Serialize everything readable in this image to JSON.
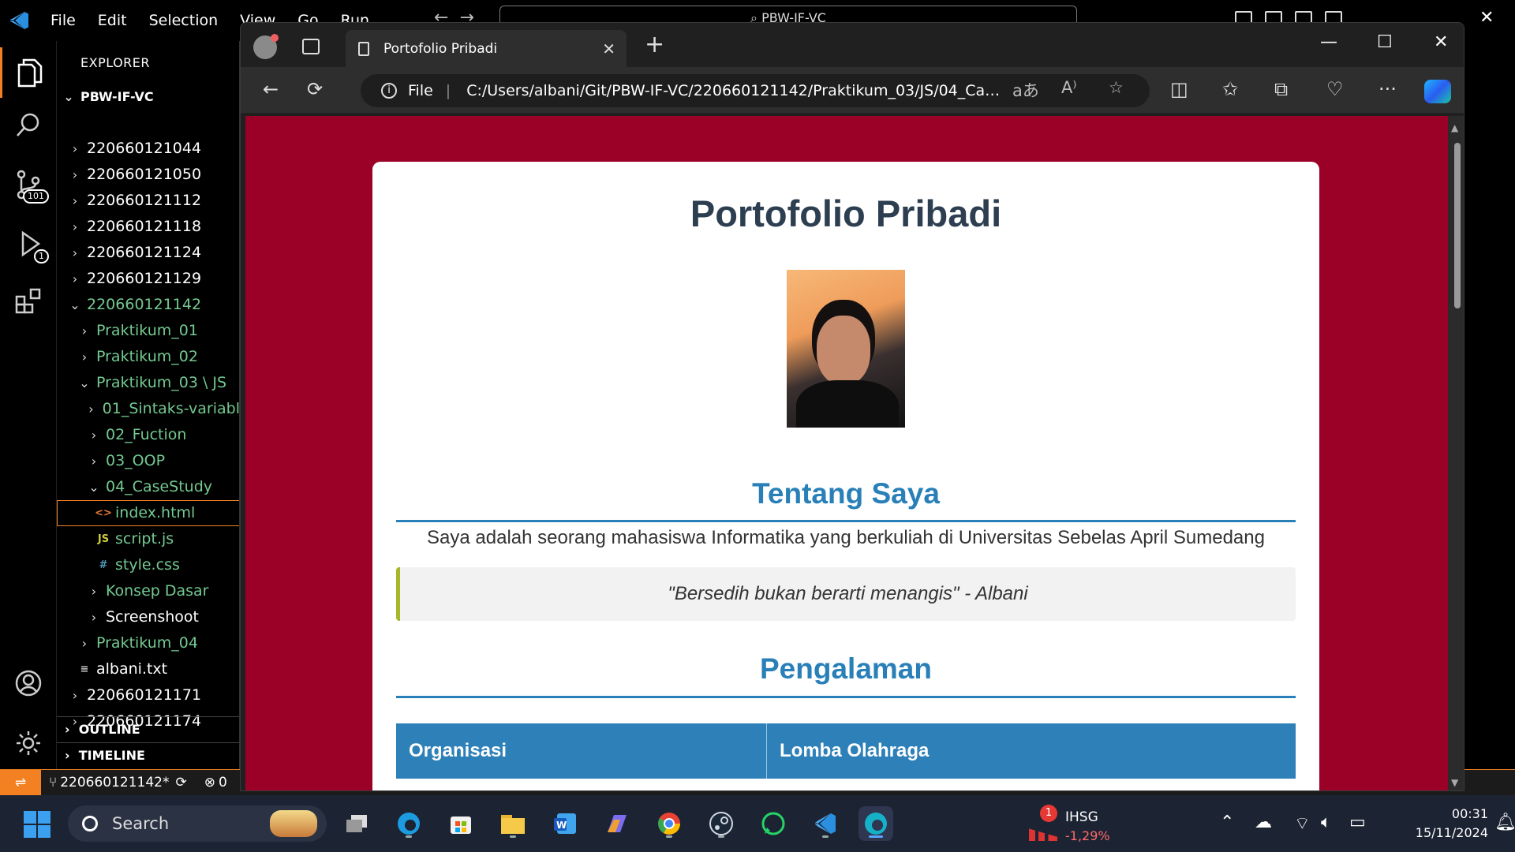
{
  "vscode": {
    "menu": [
      "File",
      "Edit",
      "Selection",
      "View",
      "Go",
      "Run",
      "…"
    ],
    "command_center": "PBW-IF-VC",
    "explorer_title": "EXPLORER",
    "root_folder": "PBW-IF-VC",
    "tree": [
      {
        "label": "220660121044",
        "kind": "folder",
        "open": false,
        "level": 0,
        "color": "white"
      },
      {
        "label": "220660121050",
        "kind": "folder",
        "open": false,
        "level": 0,
        "color": "white"
      },
      {
        "label": "220660121112",
        "kind": "folder",
        "open": false,
        "level": 0,
        "color": "white"
      },
      {
        "label": "220660121118",
        "kind": "folder",
        "open": false,
        "level": 0,
        "color": "white"
      },
      {
        "label": "220660121124",
        "kind": "folder",
        "open": false,
        "level": 0,
        "color": "white"
      },
      {
        "label": "220660121129",
        "kind": "folder",
        "open": false,
        "level": 0,
        "color": "white"
      },
      {
        "label": "220660121142",
        "kind": "folder",
        "open": true,
        "level": 0,
        "color": "green"
      },
      {
        "label": "Praktikum_01",
        "kind": "folder",
        "open": false,
        "level": 1,
        "color": "green"
      },
      {
        "label": "Praktikum_02",
        "kind": "folder",
        "open": false,
        "level": 1,
        "color": "green"
      },
      {
        "label": "Praktikum_03 \\ JS",
        "kind": "folder",
        "open": true,
        "level": 1,
        "color": "green"
      },
      {
        "label": "01_Sintaks-variabl",
        "kind": "folder",
        "open": false,
        "level": 2,
        "color": "green"
      },
      {
        "label": "02_Fuction",
        "kind": "folder",
        "open": false,
        "level": 2,
        "color": "green"
      },
      {
        "label": "03_OOP",
        "kind": "folder",
        "open": false,
        "level": 2,
        "color": "green"
      },
      {
        "label": "04_CaseStudy",
        "kind": "folder",
        "open": true,
        "level": 2,
        "color": "green"
      },
      {
        "label": "index.html",
        "kind": "html",
        "level": 3,
        "color": "green",
        "selected": true
      },
      {
        "label": "script.js",
        "kind": "js",
        "level": 3,
        "color": "green"
      },
      {
        "label": "style.css",
        "kind": "css",
        "level": 3,
        "color": "green"
      },
      {
        "label": "Konsep Dasar",
        "kind": "folder",
        "open": false,
        "level": 2,
        "color": "green"
      },
      {
        "label": "Screenshoot",
        "kind": "folder",
        "open": false,
        "level": 2,
        "color": "white"
      },
      {
        "label": "Praktikum_04",
        "kind": "folder",
        "open": false,
        "level": 1,
        "color": "green"
      },
      {
        "label": "albani.txt",
        "kind": "txt",
        "level": 1,
        "color": "white"
      },
      {
        "label": "220660121171",
        "kind": "folder",
        "open": false,
        "level": 0,
        "color": "white"
      },
      {
        "label": "220660121174",
        "kind": "folder",
        "open": false,
        "level": 0,
        "color": "white"
      }
    ],
    "outline_label": "OUTLINE",
    "timeline_label": "TIMELINE",
    "source_control_badge": "101",
    "run_badge": "1",
    "status": {
      "branch": "220660121142*",
      "errors": "0"
    }
  },
  "edge": {
    "tab_title": "Portofolio Pribadi",
    "address_prefix": "File",
    "address_url": "C:/Users/albani/Git/PBW-IF-VC/220660121142/Praktikum_03/JS/04_Ca…"
  },
  "page": {
    "title": "Portofolio Pribadi",
    "about_heading": "Tentang Saya",
    "about_text": "Saya adalah seorang mahasiswa Informatika yang berkuliah di Universitas Sebelas April Sumedang",
    "quote": "\"Bersedih bukan berarti menangis\" - Albani",
    "experience_heading": "Pengalaman",
    "table_headers": [
      "Organisasi",
      "Lomba Olahraga"
    ]
  },
  "taskbar": {
    "search_placeholder": "Search",
    "stock_name": "IHSG",
    "stock_change": "-1,29%",
    "stock_badge": "1",
    "time": "00:31",
    "date": "15/11/2024"
  },
  "colors": {
    "page_background": "#9b0026",
    "heading_blue": "#2980b9",
    "title_dark": "#2c3e50",
    "vscode_accent": "#f48121",
    "git_green": "#73c991"
  }
}
